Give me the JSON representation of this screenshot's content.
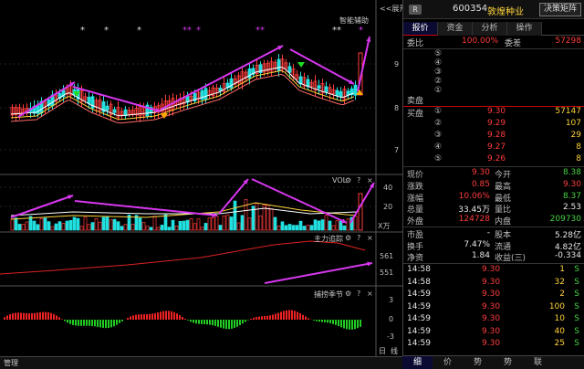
{
  "chart": {
    "expand_label": "<<展开",
    "indicator_main": "智能辅助",
    "stars": [
      "*",
      "*",
      "*",
      "**",
      "*",
      "**",
      "**",
      "*"
    ],
    "price_ticks": [
      "9",
      "8",
      "7"
    ],
    "vol_label": "VOL",
    "vol_ticks": [
      "40",
      "20"
    ],
    "vol_unit": "X万",
    "ctrl_label": "主力追踪",
    "ctrl_ticks": [
      "561",
      "551"
    ],
    "season_label": "捕捞季节",
    "season_ticks": [
      "3",
      "0",
      "-3"
    ],
    "icons": [
      "gear-icon",
      "help-icon",
      "close-icon"
    ],
    "day_label": "日",
    "line_label": "线",
    "status_left": "管理"
  },
  "panel": {
    "badge": "R",
    "code": "600354",
    "name": "敦煌种业",
    "decision_btn": "决策矩阵",
    "tabs": [
      "报价",
      "资金",
      "分析",
      "操作"
    ],
    "webi": {
      "label": "委比",
      "pct": "100.00%",
      "diff_label": "委差",
      "diff": "57298"
    },
    "sell_levels": [
      "⑤",
      "④",
      "③",
      "②",
      "①"
    ],
    "sell_label": "卖盘",
    "buy_label": "买盘",
    "buys": [
      {
        "n": "①",
        "p": "9.30",
        "v": "57147"
      },
      {
        "n": "②",
        "p": "9.29",
        "v": "107"
      },
      {
        "n": "③",
        "p": "9.28",
        "v": "29"
      },
      {
        "n": "④",
        "p": "9.27",
        "v": "8"
      },
      {
        "n": "⑤",
        "p": "9.26",
        "v": "8"
      }
    ],
    "stats": [
      {
        "l1": "现价",
        "v1": "9.30",
        "c1": "red",
        "l2": "今开",
        "v2": "8.38",
        "c2": "green"
      },
      {
        "l1": "涨跌",
        "v1": "0.85",
        "c1": "red",
        "l2": "最高",
        "v2": "9.30",
        "c2": "red"
      },
      {
        "l1": "涨幅",
        "v1": "10.06%",
        "c1": "red",
        "l2": "最低",
        "v2": "8.37",
        "c2": "green"
      },
      {
        "l1": "总量",
        "v1": "33.45万",
        "c1": "white",
        "l2": "量比",
        "v2": "2.53",
        "c2": "white"
      },
      {
        "l1": "外盘",
        "v1": "124728",
        "c1": "red",
        "l2": "内盘",
        "v2": "209730",
        "c2": "green"
      }
    ],
    "info": [
      {
        "l1": "市盈",
        "v1": "-",
        "l2": "股本",
        "v2": "5.28亿"
      },
      {
        "l1": "换手",
        "v1": "7.47%",
        "l2": "流通",
        "v2": "4.82亿"
      },
      {
        "l1": "净资",
        "v1": "1.84",
        "l2": "收益(三)",
        "v2": "-0.334"
      }
    ],
    "trades": [
      {
        "t": "14:58",
        "p": "9.30",
        "v": "1",
        "s": "S"
      },
      {
        "t": "14:58",
        "p": "9.30",
        "v": "32",
        "s": "S"
      },
      {
        "t": "14:59",
        "p": "9.30",
        "v": "2",
        "s": "S"
      },
      {
        "t": "14:59",
        "p": "9.30",
        "v": "100",
        "s": "S"
      },
      {
        "t": "14:59",
        "p": "9.30",
        "v": "10",
        "s": "S"
      },
      {
        "t": "14:59",
        "p": "9.30",
        "v": "40",
        "s": "S"
      },
      {
        "t": "14:59",
        "p": "9.30",
        "v": "25",
        "s": "S"
      }
    ],
    "bottom_tabs": [
      "细",
      "价",
      "势",
      "势",
      "联"
    ]
  },
  "colors": {
    "up": "#ff3c3c",
    "down": "#22e0e0",
    "arrow": "#d837f0",
    "ma1": "#ffffff",
    "ma2": "#ffd33c",
    "ma3": "#ff6a6a"
  }
}
